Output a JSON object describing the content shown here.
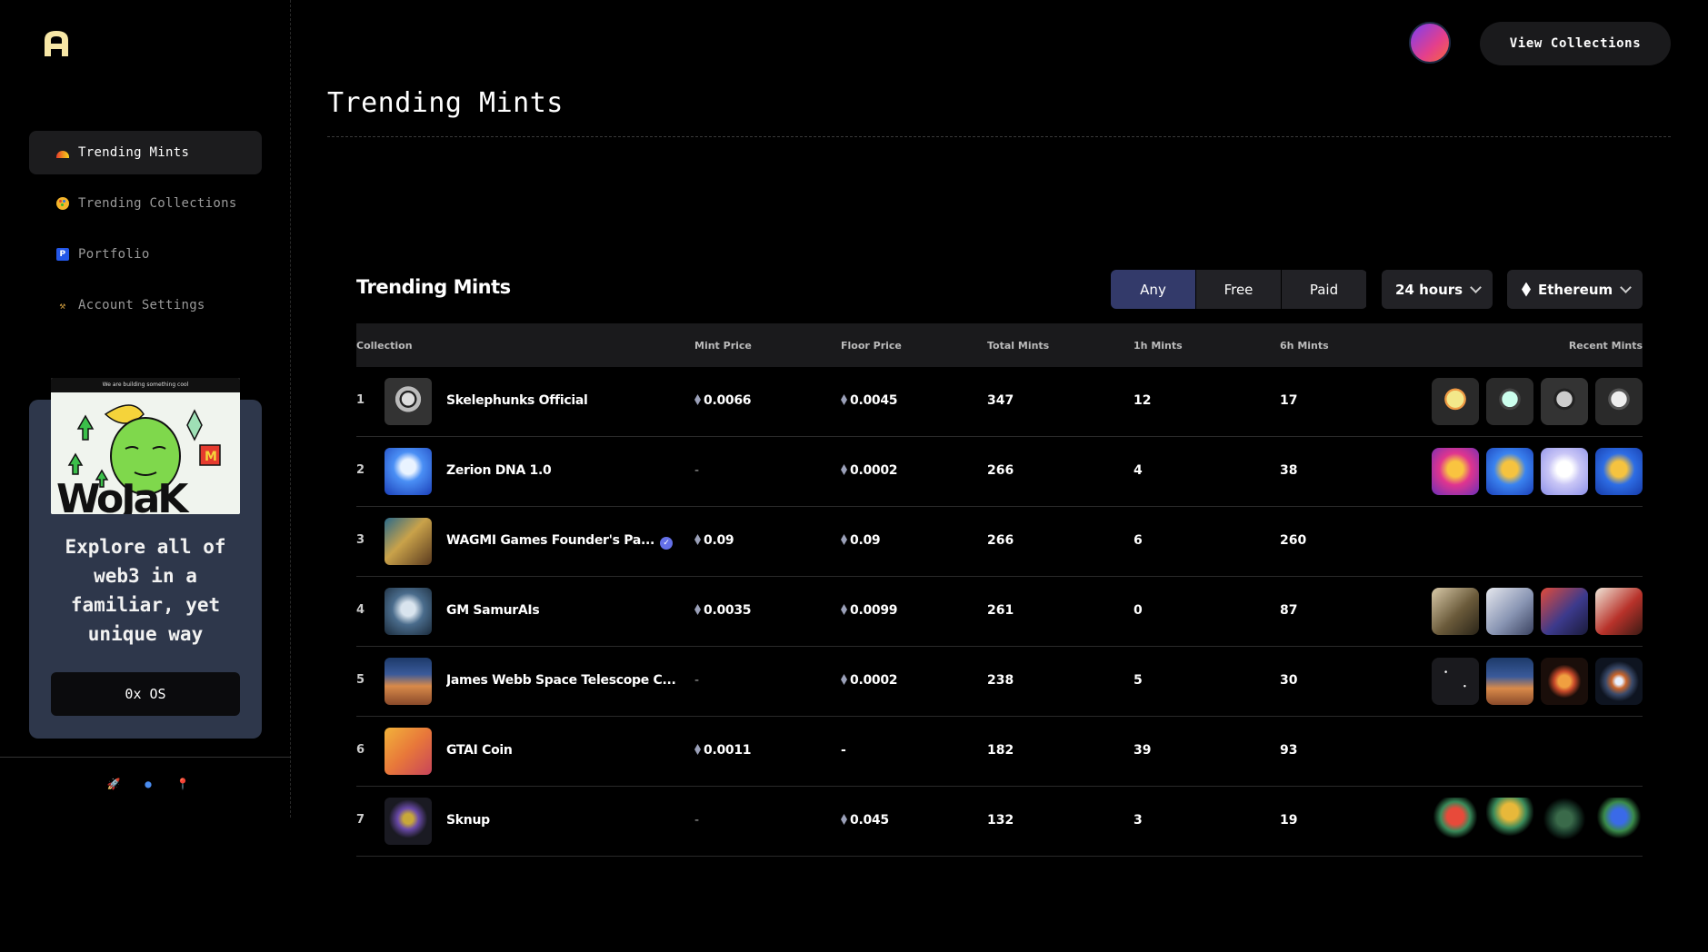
{
  "sidebar": {
    "nav": [
      {
        "label": "Trending Mints",
        "icon": "rainbow-icon",
        "active": true
      },
      {
        "label": "Trending Collections",
        "icon": "palette-icon",
        "active": false
      },
      {
        "label": "Portfolio",
        "icon": "portfolio-icon",
        "active": false
      },
      {
        "label": "Account Settings",
        "icon": "hammer-icon",
        "active": false
      }
    ],
    "promo": {
      "banner": "We are building something cool",
      "text": "Explore all of web3 in a familiar, yet unique way",
      "button": "0x OS"
    },
    "social_icons": [
      "rocket-icon",
      "discord-icon",
      "pin-icon"
    ]
  },
  "header": {
    "view_collections": "View Collections",
    "page_title": "Trending Mints"
  },
  "table": {
    "title": "Trending Mints",
    "filter_price": {
      "options": [
        "Any",
        "Free",
        "Paid"
      ],
      "selected": "Any"
    },
    "filter_time": "24 hours",
    "filter_chain": "Ethereum",
    "columns": [
      "Collection",
      "Mint Price",
      "Floor Price",
      "Total Mints",
      "1h Mints",
      "6h Mints",
      "Recent Mints"
    ],
    "rows": [
      {
        "rank": "1",
        "name": "Skelephunks Official",
        "verified": false,
        "mint": "0.0066",
        "floor": "0.0045",
        "total": "347",
        "h1": "12",
        "h6": "17",
        "has_recent": true
      },
      {
        "rank": "2",
        "name": "Zerion DNA 1.0",
        "verified": false,
        "mint": "-",
        "floor": "0.0002",
        "total": "266",
        "h1": "4",
        "h6": "38",
        "has_recent": true
      },
      {
        "rank": "3",
        "name": "WAGMI Games Founder's Pa...",
        "verified": true,
        "mint": "0.09",
        "floor": "0.09",
        "total": "266",
        "h1": "6",
        "h6": "260",
        "has_recent": false
      },
      {
        "rank": "4",
        "name": "GM SamurAIs",
        "verified": false,
        "mint": "0.0035",
        "floor": "0.0099",
        "total": "261",
        "h1": "0",
        "h6": "87",
        "has_recent": true
      },
      {
        "rank": "5",
        "name": "James Webb Space Telescope C...",
        "verified": false,
        "mint": "-",
        "floor": "0.0002",
        "total": "238",
        "h1": "5",
        "h6": "30",
        "has_recent": true
      },
      {
        "rank": "6",
        "name": "GTAI Coin",
        "verified": false,
        "mint": "0.0011",
        "floor": "-",
        "total": "182",
        "h1": "39",
        "h6": "93",
        "has_recent": false
      },
      {
        "rank": "7",
        "name": "Sknup",
        "verified": false,
        "mint": "-",
        "floor": "0.045",
        "total": "132",
        "h1": "3",
        "h6": "19",
        "has_recent": true
      }
    ]
  },
  "colors": {
    "background": "#000000",
    "active_segment": "#333a6a",
    "promo_card": "#2e374b",
    "verified_badge": "#6470e8"
  }
}
